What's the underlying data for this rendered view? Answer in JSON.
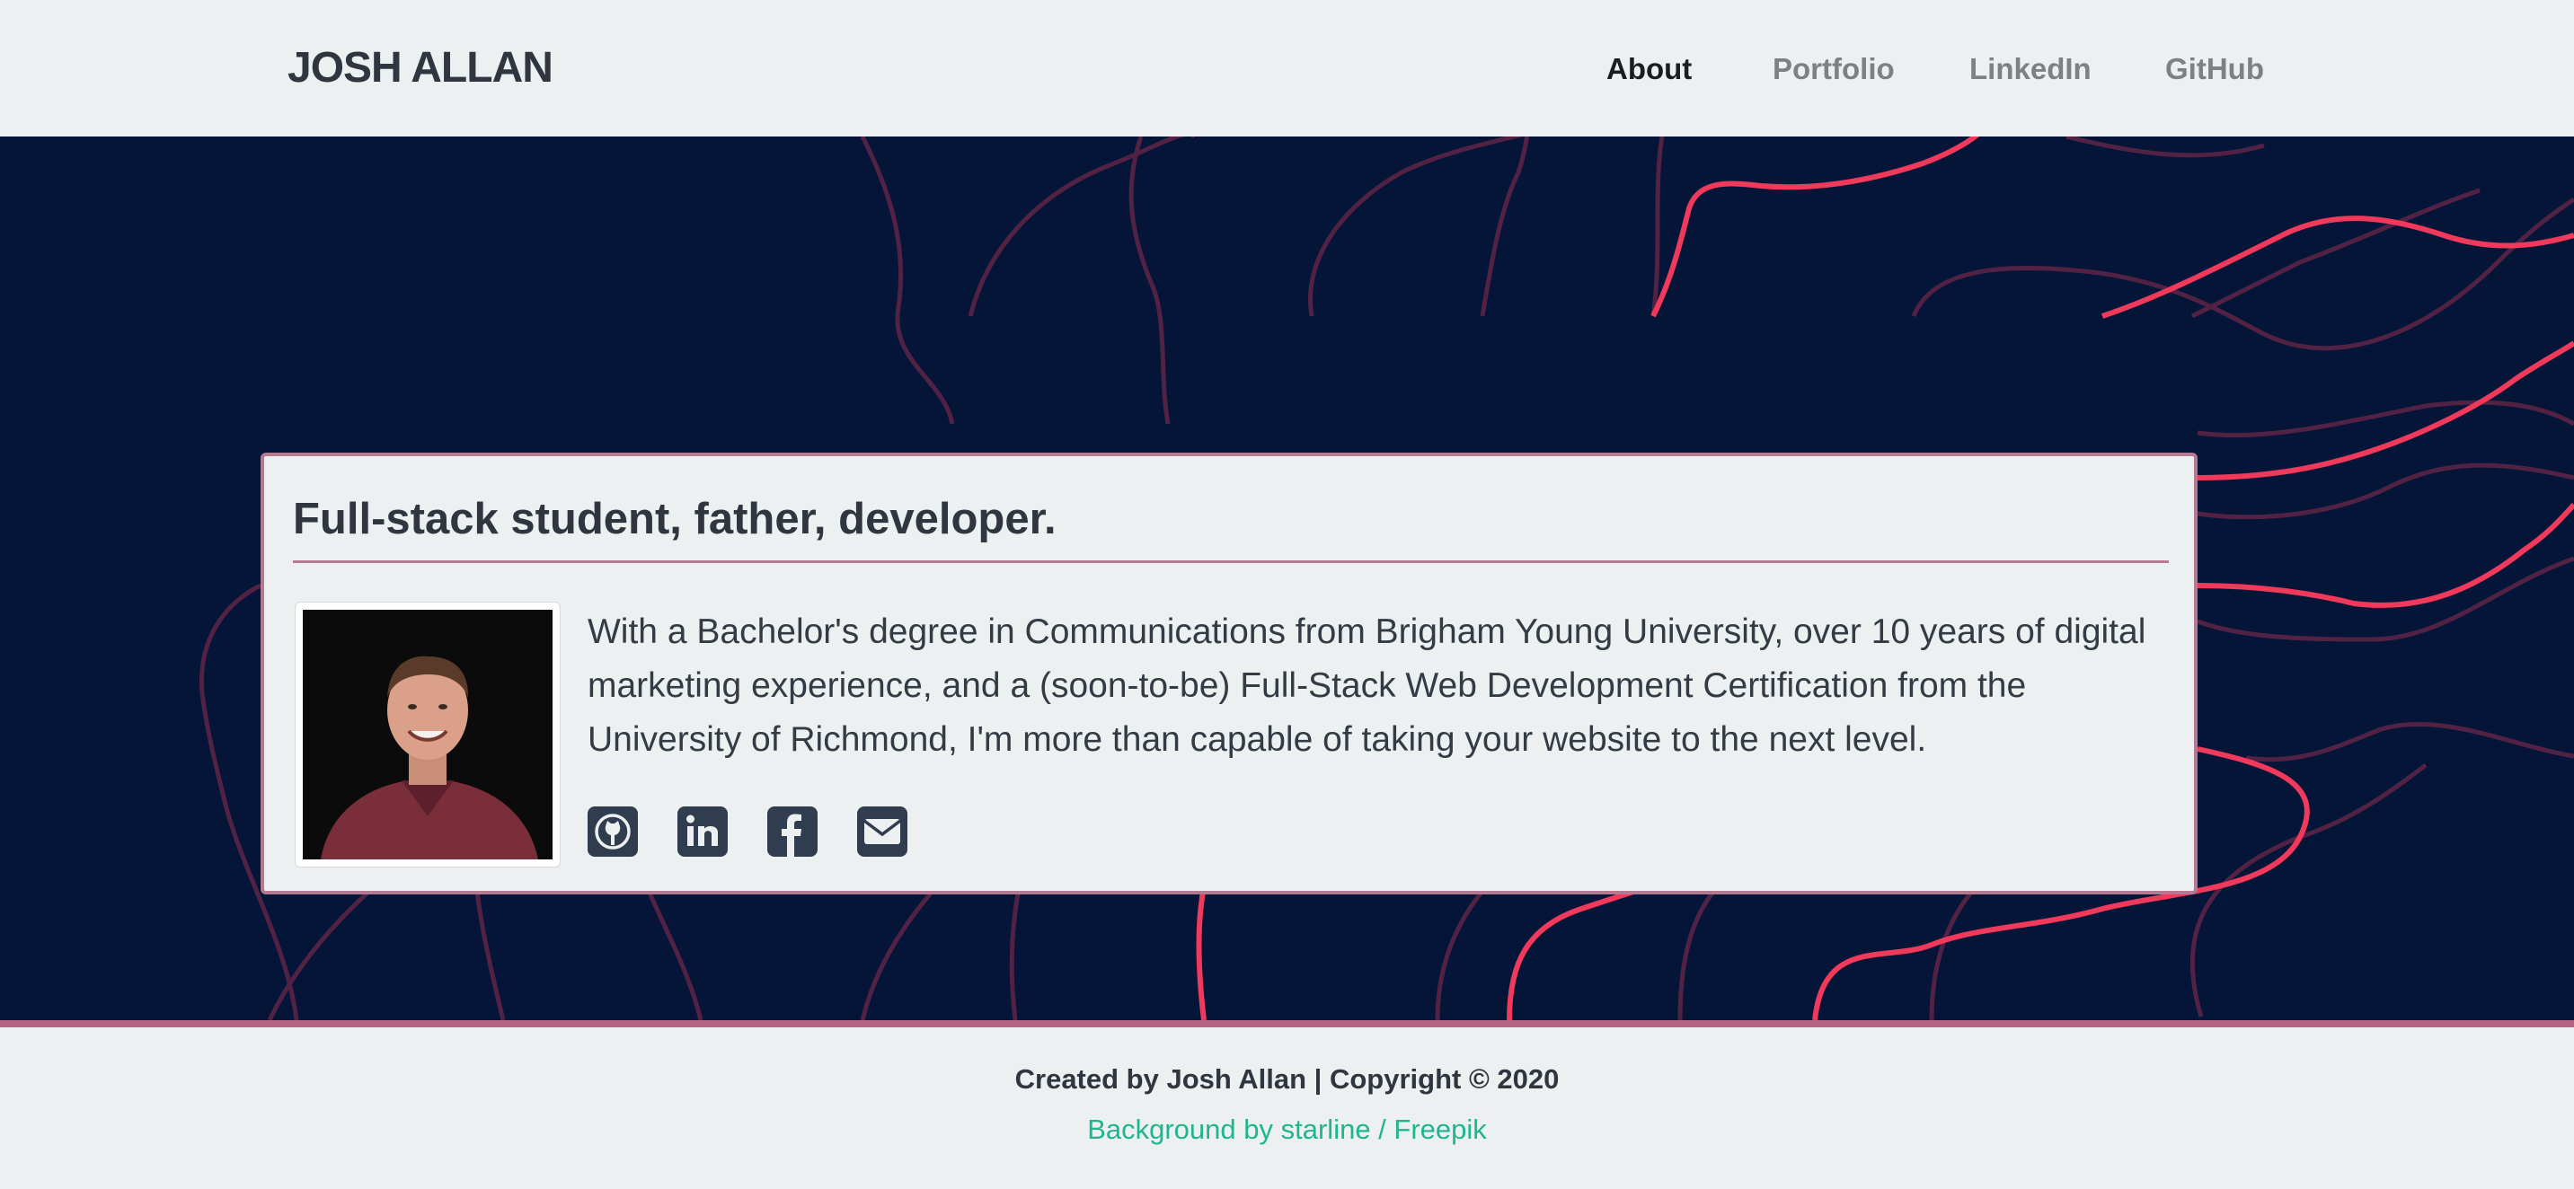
{
  "header": {
    "brand": "JOSH ALLAN",
    "nav": [
      {
        "label": "About",
        "active": true
      },
      {
        "label": "Portfolio",
        "active": false
      },
      {
        "label": "LinkedIn",
        "active": false
      },
      {
        "label": "GitHub",
        "active": false
      }
    ]
  },
  "about": {
    "title": "Full-stack student, father, developer.",
    "bio": "With a Bachelor's degree in Communications from Brigham Young University, over 10 years of digital marketing experience, and a (soon-to-be) Full-Stack Web Development Certification from the University of Richmond, I'm more than capable of taking your website to the next level.",
    "photo_icon": "profile-photo",
    "socials": [
      {
        "icon": "github-icon"
      },
      {
        "icon": "linkedin-icon"
      },
      {
        "icon": "facebook-icon"
      },
      {
        "icon": "envelope-icon"
      }
    ]
  },
  "footer": {
    "copyright": "Created by Josh Allan | Copyright © 2020",
    "credit_prefix": "Background by ",
    "credit_link_1": "starline",
    "credit_separator": " / ",
    "credit_link_2": "Freepik"
  },
  "colors": {
    "hero_background": "#041537",
    "line_bright": "#f0395b",
    "line_dim": "#6e2848",
    "card_border": "#b47a92",
    "footer_border": "#b56581",
    "link": "#1fb58f",
    "icon": "#2f3d4e"
  }
}
